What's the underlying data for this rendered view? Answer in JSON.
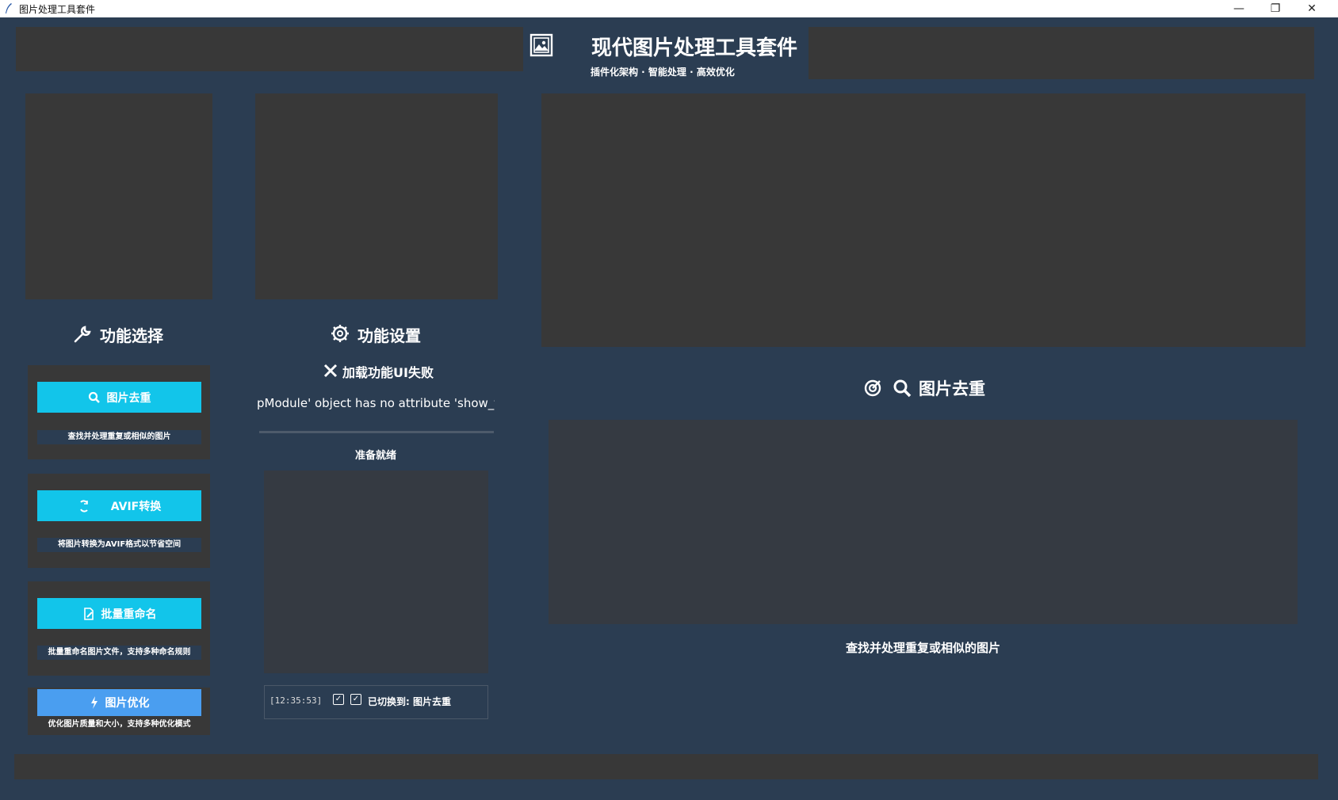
{
  "window": {
    "title": "图片处理工具套件",
    "minimize": "—",
    "restore": "❐",
    "close": "✕"
  },
  "header": {
    "title": "现代图片处理工具套件",
    "subtitle": "插件化架构 · 智能处理 · 高效优化"
  },
  "left_panel": {
    "heading": "功能选择",
    "cards": [
      {
        "label": "图片去重",
        "desc": "查找并处理重复或相似的图片",
        "icon": "search-icon"
      },
      {
        "label": "AVIF转换",
        "desc": "将图片转换为AVIF格式以节省空间",
        "icon": "convert-icon"
      },
      {
        "label": "批量重命名",
        "desc": "批量重命名图片文件，支持多种命名规则",
        "icon": "edit-file-icon"
      },
      {
        "label": "图片优化",
        "desc": "优化图片质量和大小，支持多种优化模式",
        "icon": "lightning-icon"
      }
    ]
  },
  "middle_panel": {
    "heading": "功能设置",
    "error_title": "加载功能UI失败",
    "error_message": "pModule' object has no attribute 'show_feed",
    "status": "准备就绪",
    "log_time": "[12:35:53]",
    "log_message": "已切换到: 图片去重"
  },
  "right_panel": {
    "heading": "图片去重",
    "description": "查找并处理重复或相似的图片"
  },
  "colors": {
    "accent": "#12c5ea",
    "accent_active": "#4a9ef0",
    "background": "#2b3d52",
    "panel": "#383838"
  }
}
